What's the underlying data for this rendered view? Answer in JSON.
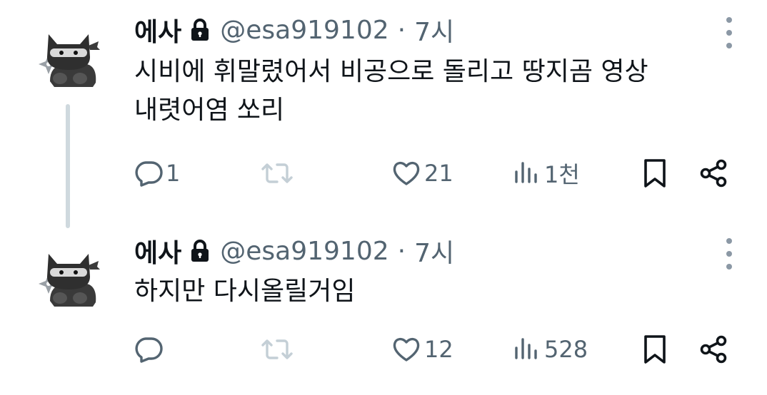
{
  "tweets": [
    {
      "name": "에사",
      "handle": "@esa919102",
      "separator": "·",
      "time": "7시",
      "lines": [
        "시비에 휘말렸어서 비공으로 돌리고 땅지곰 영상",
        "내렷어염 쏘리"
      ],
      "replies": "1",
      "likes": "21",
      "views": "1천"
    },
    {
      "name": "에사",
      "handle": "@esa919102",
      "separator": "·",
      "time": "7시",
      "lines": [
        "하지만 다시올릴거임"
      ],
      "replies": "",
      "likes": "12",
      "views": "528"
    }
  ],
  "icons": {
    "avatar": "ninja-cat-avatar",
    "lock": "lock-icon",
    "more": "more-vertical-icon",
    "reply": "reply-icon",
    "retweet": "retweet-icon",
    "like": "heart-icon",
    "views": "views-icon",
    "bookmark": "bookmark-icon",
    "share": "share-icon"
  },
  "colors": {
    "text": "#0f1419",
    "secondary": "#536471",
    "thread_line": "#cfd9de",
    "retweet_disabled": "#c4cfd6"
  }
}
